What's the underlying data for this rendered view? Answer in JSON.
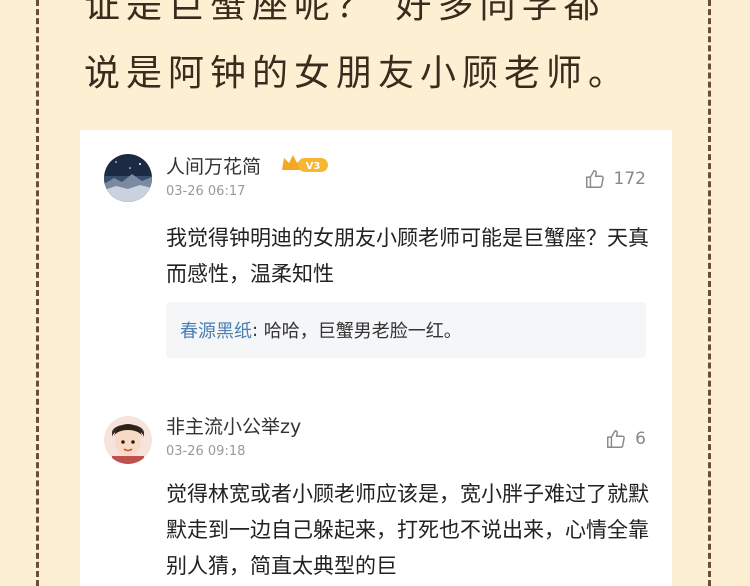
{
  "header": {
    "line1": "证是巨蟹座呢？  好多同学都",
    "line2": "说是阿钟的女朋友小顾老师。"
  },
  "comments": [
    {
      "username": "人间万花简",
      "badge": "V3",
      "timestamp": "03-26 06:17",
      "likes": "172",
      "text": "我觉得钟明迪的女朋友小顾老师可能是巨蟹座？天真而感性，温柔知性",
      "reply": {
        "name": "春源黑纸",
        "separator": ": ",
        "text": "哈哈，巨蟹男老脸一红。"
      }
    },
    {
      "username": "非主流小公举zy",
      "timestamp": "03-26 09:18",
      "likes": "6",
      "text": "觉得林宽或者小顾老师应该是，宽小胖子难过了就默默走到一边自己躲起来，打死也不说出来，心情全靠别人猜，简直太典型的巨"
    }
  ],
  "colors": {
    "background": "#fdf0d2",
    "frame": "#6b4b3a",
    "reply_name": "#4a7fb5",
    "badge": "#f5a623"
  },
  "icons": {
    "like": "thumbs-up-icon",
    "badge": "crown-icon"
  }
}
